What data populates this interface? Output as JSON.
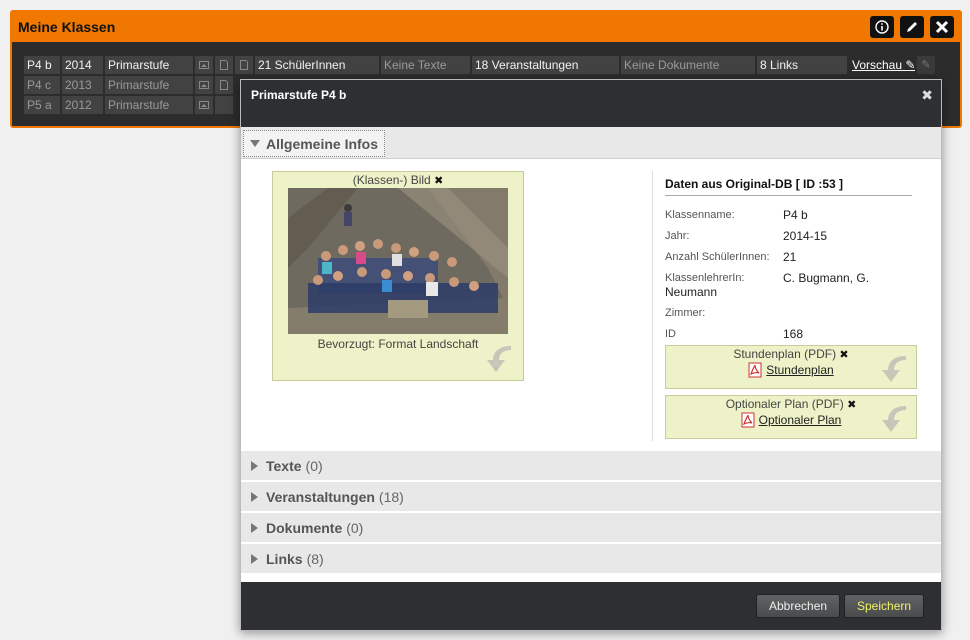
{
  "panel": {
    "title": "Meine Klassen",
    "icons": [
      "info-icon",
      "pencil-icon",
      "close-icon"
    ]
  },
  "table": {
    "rows": [
      {
        "name": "P4 b",
        "year": "2014",
        "level": "Primarstufe",
        "students": "21 SchülerInnen",
        "texts": "Keine Texte",
        "events": "18 Veranstaltungen",
        "docs": "Keine Dokumente",
        "links": "8 Links",
        "preview": "Vorschau"
      },
      {
        "name": "P4 c",
        "year": "2013",
        "level": "Primarstufe"
      },
      {
        "name": "P5 a",
        "year": "2012",
        "level": "Primarstufe"
      }
    ]
  },
  "modal": {
    "title": "Primarstufe P4 b",
    "section_open": "Allgemeine Infos",
    "image_box": {
      "label": "(Klassen-) Bild",
      "remove": "✖",
      "preferred": "Bevorzugt: Format Landschaft"
    },
    "info": {
      "title": "Daten aus Original-DB [ ID :53 ]",
      "fields": [
        {
          "key": "Klassenname:",
          "value": "P4 b"
        },
        {
          "key": "Jahr:",
          "value": "2014-15"
        },
        {
          "key": "Anzahl SchülerInnen:",
          "value": "21"
        },
        {
          "key": "KlassenlehrerIn:",
          "value": "C. Bugmann, G.",
          "value2": "Neumann"
        },
        {
          "key": "Zimmer:",
          "value": ""
        },
        {
          "key": "ID",
          "value": "168"
        }
      ]
    },
    "pdf1": {
      "label": "Stundenplan (PDF)",
      "remove": "✖",
      "link": "Stundenplan"
    },
    "pdf2": {
      "label": "Optionaler Plan (PDF)",
      "remove": "✖",
      "link": "Optionaler Plan"
    },
    "sections": [
      {
        "label": "Texte",
        "count": "(0)"
      },
      {
        "label": "Veranstaltungen",
        "count": "(18)"
      },
      {
        "label": "Dokumente",
        "count": "(0)"
      },
      {
        "label": "Links",
        "count": "(8)"
      }
    ],
    "buttons": {
      "cancel": "Abbrechen",
      "save": "Speichern"
    },
    "close": "✖"
  }
}
